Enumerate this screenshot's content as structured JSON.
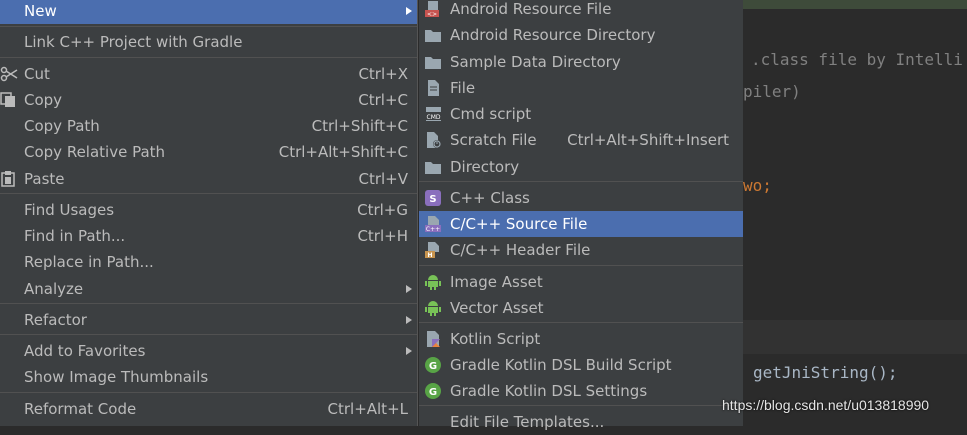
{
  "context_menu": {
    "items": [
      {
        "label": "New",
        "shortcut": "",
        "submenu": true,
        "selected": true
      },
      {
        "label": "Link C++ Project with Gradle",
        "shortcut": ""
      },
      {
        "label": "Cut",
        "shortcut": "Ctrl+X",
        "icon": "scissors-icon"
      },
      {
        "label": "Copy",
        "shortcut": "Ctrl+C",
        "icon": "copy-icon"
      },
      {
        "label": "Copy Path",
        "shortcut": "Ctrl+Shift+C"
      },
      {
        "label": "Copy Relative Path",
        "shortcut": "Ctrl+Alt+Shift+C"
      },
      {
        "label": "Paste",
        "shortcut": "Ctrl+V",
        "icon": "clipboard-icon"
      },
      {
        "label": "Find Usages",
        "shortcut": "Ctrl+G"
      },
      {
        "label": "Find in Path...",
        "shortcut": "Ctrl+H"
      },
      {
        "label": "Replace in Path...",
        "shortcut": ""
      },
      {
        "label": "Analyze",
        "shortcut": "",
        "submenu": true
      },
      {
        "label": "Refactor",
        "shortcut": "",
        "submenu": true
      },
      {
        "label": "Add to Favorites",
        "shortcut": "",
        "submenu": true
      },
      {
        "label": "Show Image Thumbnails",
        "shortcut": ""
      },
      {
        "label": "Reformat Code",
        "shortcut": "Ctrl+Alt+L"
      }
    ]
  },
  "new_submenu": {
    "items": [
      {
        "label": "Android Resource File",
        "shortcut": "",
        "icon": "android-resource-file-icon"
      },
      {
        "label": "Android Resource Directory",
        "shortcut": "",
        "icon": "folder-icon"
      },
      {
        "label": "Sample Data Directory",
        "shortcut": "",
        "icon": "folder-icon"
      },
      {
        "label": "File",
        "shortcut": "",
        "icon": "file-icon"
      },
      {
        "label": "Cmd script",
        "shortcut": "",
        "icon": "cmd-script-icon"
      },
      {
        "label": "Scratch File",
        "shortcut": "Ctrl+Alt+Shift+Insert",
        "icon": "scratch-file-icon"
      },
      {
        "label": "Directory",
        "shortcut": "",
        "icon": "folder-icon"
      },
      {
        "label": "C++ Class",
        "shortcut": "",
        "icon": "cpp-class-icon"
      },
      {
        "label": "C/C++ Source File",
        "shortcut": "",
        "icon": "cpp-source-file-icon",
        "selected": true
      },
      {
        "label": "C/C++ Header File",
        "shortcut": "",
        "icon": "cpp-header-file-icon"
      },
      {
        "label": "Image Asset",
        "shortcut": "",
        "icon": "android-icon"
      },
      {
        "label": "Vector Asset",
        "shortcut": "",
        "icon": "android-icon"
      },
      {
        "label": "Kotlin Script",
        "shortcut": "",
        "icon": "kotlin-icon"
      },
      {
        "label": "Gradle Kotlin DSL Build Script",
        "shortcut": "",
        "icon": "gradle-icon"
      },
      {
        "label": "Gradle Kotlin DSL Settings",
        "shortcut": "",
        "icon": "gradle-icon"
      },
      {
        "label": "Edit File Templates...",
        "shortcut": ""
      }
    ]
  },
  "editor": {
    "lines": [
      ".class file by Intelli",
      "piler)",
      "wo;",
      "getJniString();"
    ]
  },
  "watermark": "https://blog.csdn.net/u013818990",
  "colors": {
    "menu_bg": "#3c3f41",
    "selection": "#4b6eaf",
    "text": "#bbbbbb",
    "editor_bg": "#2b2b2b"
  }
}
